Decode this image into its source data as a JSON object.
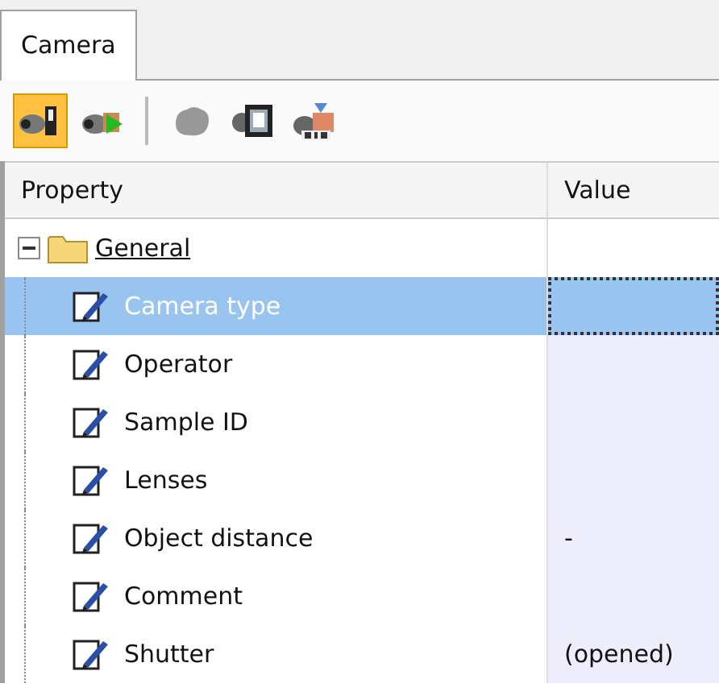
{
  "tabs": [
    {
      "label": "Camera",
      "selected": true
    }
  ],
  "toolbar": [
    {
      "kind": "camera-record",
      "selected": true
    },
    {
      "kind": "camera-play",
      "selected": false
    },
    {
      "kind": "separator"
    },
    {
      "kind": "blob",
      "selected": false
    },
    {
      "kind": "frame",
      "selected": false
    },
    {
      "kind": "mio",
      "selected": false
    }
  ],
  "grid": {
    "columns": [
      "Property",
      "Value"
    ],
    "groups": [
      {
        "label": "General",
        "expanded": true,
        "rows": [
          {
            "name": "Camera type",
            "value": "",
            "selected": true
          },
          {
            "name": "Operator",
            "value": "",
            "selected": false
          },
          {
            "name": "Sample ID",
            "value": "",
            "selected": false
          },
          {
            "name": "Lenses",
            "value": "",
            "selected": false
          },
          {
            "name": "Object distance",
            "value": "-",
            "selected": false
          },
          {
            "name": "Comment",
            "value": "",
            "selected": false
          },
          {
            "name": "Shutter",
            "value": "(opened)",
            "selected": false
          }
        ]
      }
    ]
  }
}
